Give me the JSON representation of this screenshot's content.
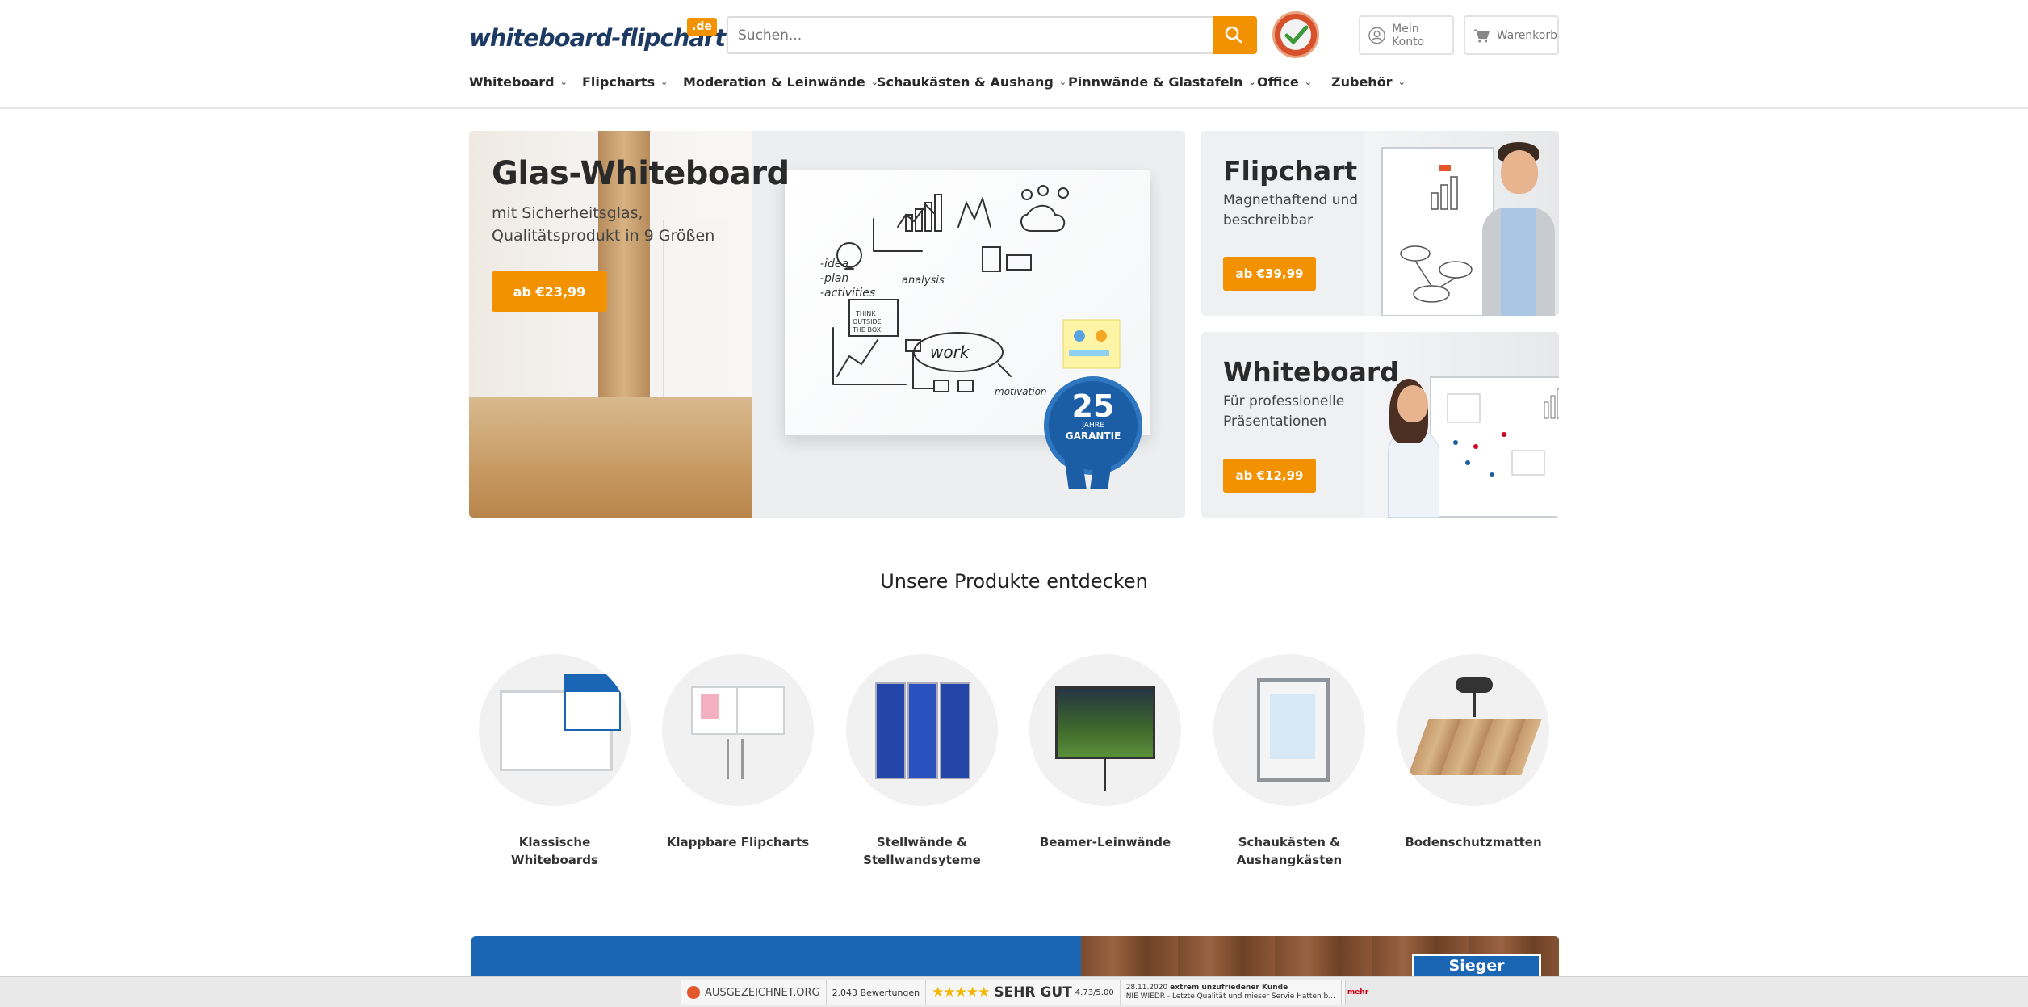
{
  "header": {
    "logo_text": "whiteboard-flipchart",
    "logo_tld": ".de",
    "search_placeholder": "Suchen...",
    "account_label": "Mein Konto",
    "cart_label": "Warenkorb"
  },
  "nav": {
    "items": [
      {
        "label": "Whiteboard"
      },
      {
        "label": "Flipcharts"
      },
      {
        "label": "Moderation & Leinwände"
      },
      {
        "label": "Schaukästen & Aushang"
      },
      {
        "label": "Pinnwände & Glastafeln"
      },
      {
        "label": "Office"
      },
      {
        "label": "Zubehör"
      }
    ]
  },
  "hero": {
    "title": "Glas-Whiteboard",
    "subtitle": "mit Sicherheitsglas, Qualitätsprodukt in 9 Größen",
    "cta": "ab €23,99",
    "badge_number": "25",
    "badge_line1": "JAHRE",
    "badge_line2": "GARANTIE"
  },
  "side_cards": {
    "flipchart": {
      "title": "Flipchart",
      "subtitle": "Magnethaftend und beschreibbar",
      "cta": "ab €39,99"
    },
    "whiteboard": {
      "title": "Whiteboard",
      "subtitle": "Für professionelle Präsentationen",
      "cta": "ab €12,99"
    }
  },
  "products": {
    "title": "Unsere Produkte entdecken",
    "items": [
      {
        "label": "Klassische Whiteboards"
      },
      {
        "label": "Klappbare Flipcharts"
      },
      {
        "label": "Stellwände & Stellwandsyteme"
      },
      {
        "label": "Beamer-Leinwände"
      },
      {
        "label": "Schaukästen & Aushangkästen"
      },
      {
        "label": "Bodenschutzmatten"
      }
    ]
  },
  "banner": {
    "badge_text": "Sieger"
  },
  "rating_bar": {
    "brand": "AUSGEZEICHNET.ORG",
    "count": "2.043 Bewertungen",
    "stars": "★★★★★",
    "grade": "SEHR GUT",
    "score": "4.73/5.00",
    "review_date": "28.11.2020",
    "review_title": "extrem unzufriedener Kunde",
    "review_text": "NIE WIEDR - Letzte Qualität und mieser Servie Hatten b...",
    "more": "mehr"
  },
  "colors": {
    "accent": "#f39200",
    "brand_blue": "#1c3a63",
    "badge_blue": "#1b5ea6"
  }
}
